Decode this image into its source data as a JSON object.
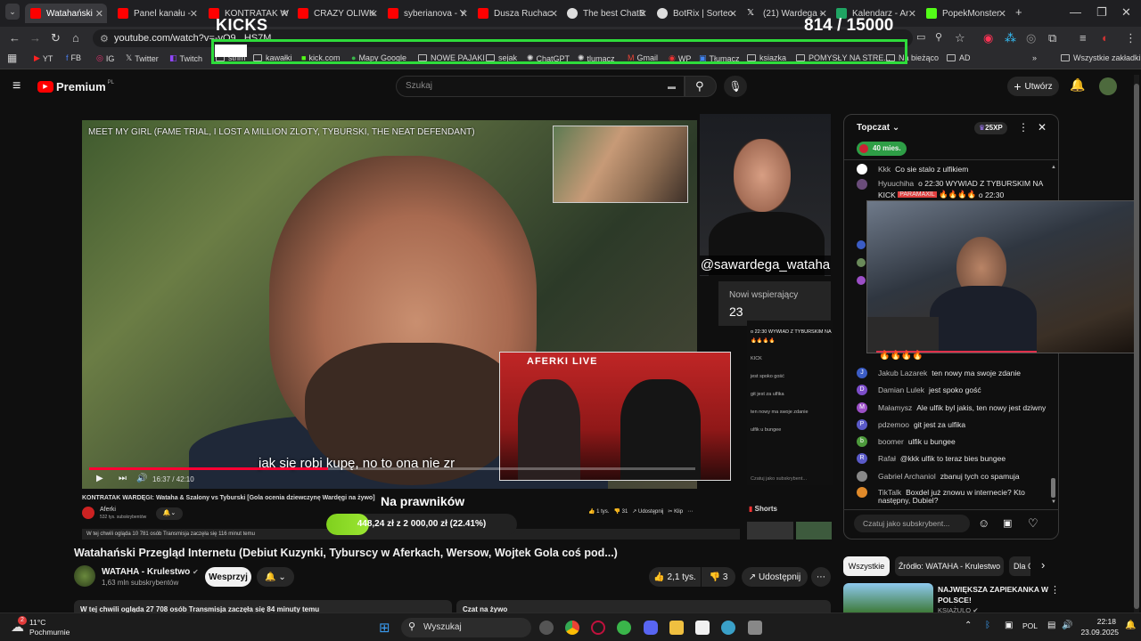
{
  "tabs": [
    {
      "label": "Watahański",
      "color": "#ff0000",
      "active": true
    },
    {
      "label": "Panel kanału - ",
      "color": "#ff0000"
    },
    {
      "label": "KONTRATAK W",
      "color": "#ff0000"
    },
    {
      "label": "CRAZY OLIWK",
      "color": "#ff0000"
    },
    {
      "label": "syberianova - Y",
      "color": "#ff0000"
    },
    {
      "label": "Dusza Ruchac",
      "color": "#ff0000"
    },
    {
      "label": "The best ChatB",
      "color": "#dddddd"
    },
    {
      "label": "BotRix | Sorteo",
      "color": "#dddddd"
    },
    {
      "label": "(21) Wardega -",
      "color": "#dddddd"
    },
    {
      "label": "Kalendarz - Ar",
      "color": "#1fa463"
    },
    {
      "label": "PopekMonster",
      "color": "#53fc18"
    }
  ],
  "address": {
    "url": "youtube.com/watch?v=-vO9...HS7M"
  },
  "bookmarks": [
    "YT",
    "FB",
    "IG",
    "Twitter",
    "Twitch",
    "strim",
    "kawałki",
    "kick.com",
    "Mapy Google",
    "NOWE PAJAKI",
    "sejak",
    "ChatGPT",
    "tlumacz",
    "Gmail",
    "WP",
    "Tłumacz",
    "ksiazka",
    "POMYSŁY NA STRE...",
    "Na bieżąco",
    "AD",
    "Wszystkie zakładki"
  ],
  "overlay": {
    "kicks_label": "KICKS",
    "counter": "814  / 15000",
    "video_caption": "MEET MY GIRL (FAME TRIAL, I LOST A MILLION ZLOTY, TYBURSKI, THE NEAT DEFENDANT)",
    "subtitle": "jak się robi kupę, no to ona nie zr",
    "webcam_name": "@sawardega_wataha",
    "nowi_label": "Nowi wspierający",
    "nowi_count": "23",
    "pip_logo": "AFERKI LIVE"
  },
  "yt": {
    "logo": "Premium",
    "logo_sup": "PL",
    "search_placeholder": "Szukaj",
    "create": "Utwórz"
  },
  "player": {
    "time": "16:37 / 42:10",
    "progress": 0.394
  },
  "inner": {
    "title": "KONTRATAK WARDĘGI: Wataha & Szalony vs Tyburski [Gola ocenia dziewczynę Wardęgi na żywo]",
    "channel": "Aferki",
    "subs": "532 tys. subskrybentów",
    "likes": "1 tys.",
    "dislikes": "31",
    "share": "Udostępnij",
    "clip": "Klip",
    "shorts": "Shorts",
    "watching": "W tej chwili ogląda 10 781 osób  Transmisja zaczęła się 116 minut temu",
    "chat_placeholder": "Czatuj jako subskrybent..."
  },
  "donation": {
    "title": "Na prawników",
    "text": "448,24 zł  z  2 000,00 zł  (22.41%)",
    "fraction": 0.2241
  },
  "chat": {
    "mode": "Topczat",
    "xp": "25XP",
    "member_badge": "40 mies.",
    "input_placeholder": "Czatuj jako subskrybent...",
    "messages": [
      {
        "author": "Kkk",
        "text": "Co sie stalo z ulfikiem",
        "color": "#ffffff",
        "initial": ""
      },
      {
        "author": "Hyuuchiha",
        "text": "o 22:30 WYWIAD Z TYBURSKIM NA",
        "color": "#6a4c7a",
        "initial": ""
      },
      {
        "author": "Jakub Lazarek",
        "text": "ten nowy ma swoje zdanie",
        "color": "#3b5cc4",
        "initial": "J"
      },
      {
        "author": "Damian Lulek",
        "text": "jest spoko gość",
        "color": "#7c4dc9",
        "initial": "D"
      },
      {
        "author": "Małamysz",
        "text": "Ale ulfik byl jakis, ten nowy jest dziwny",
        "color": "#9c4fc7",
        "initial": "M"
      },
      {
        "author": "pdzemoo",
        "text": "git jest za ulfika",
        "color": "#5a5ac8",
        "initial": "P"
      },
      {
        "author": "boomer",
        "text": "ulfik u bungee",
        "color": "#4d9a3c",
        "initial": "b"
      },
      {
        "author": "Rafał",
        "text": "@kkk ulfik to teraz bies bungee",
        "color": "#5a5ac8",
        "initial": "R"
      },
      {
        "author": "Gabriel Archaniol",
        "text": "zbanuj tych co spamuja",
        "color": "#888888",
        "initial": ""
      },
      {
        "author": "TikTalk",
        "text": "Boxdel już znowu w internecie? Kto",
        "color": "#e08a2a",
        "initial": ""
      }
    ],
    "kick_line": "KICK",
    "paramaxil": "PARAMAXIL",
    "fire_time": "o 22:30",
    "tiktalk_cont": "następny, Dubiel?"
  },
  "video": {
    "title": "Watahański Przegląd Internetu (Debiut Kuzynki, Tyburscy w Aferkach, Wersow, Wojtek Gola coś pod...)",
    "channel": "WATAHA - Krulestwo",
    "subs": "1,63 mln subskrybentów",
    "support": "Wesprzyj",
    "likes": "2,1 tys.",
    "dislikes": "3",
    "share": "Udostępnij",
    "watching": "W tej chwili ogląda 27 708 osób  Transmisja zaczęła się 84 minuty temu",
    "chat_replay": "Czat na żywo"
  },
  "related": {
    "chips": [
      "Wszystkie",
      "Źródło: WATAHA - Krulestwo",
      "Dla C"
    ],
    "item_title": "NAJWIĘKSZA ZAPIEKANKA W POLSCE!",
    "item_channel": "KSIĄŻULO"
  },
  "taskbar": {
    "temp": "11°C",
    "weather": "Pochmurnie",
    "search": "Wyszukaj",
    "lang": "POL",
    "time": "22:18",
    "date": "23.09.2025",
    "badge": "2"
  }
}
